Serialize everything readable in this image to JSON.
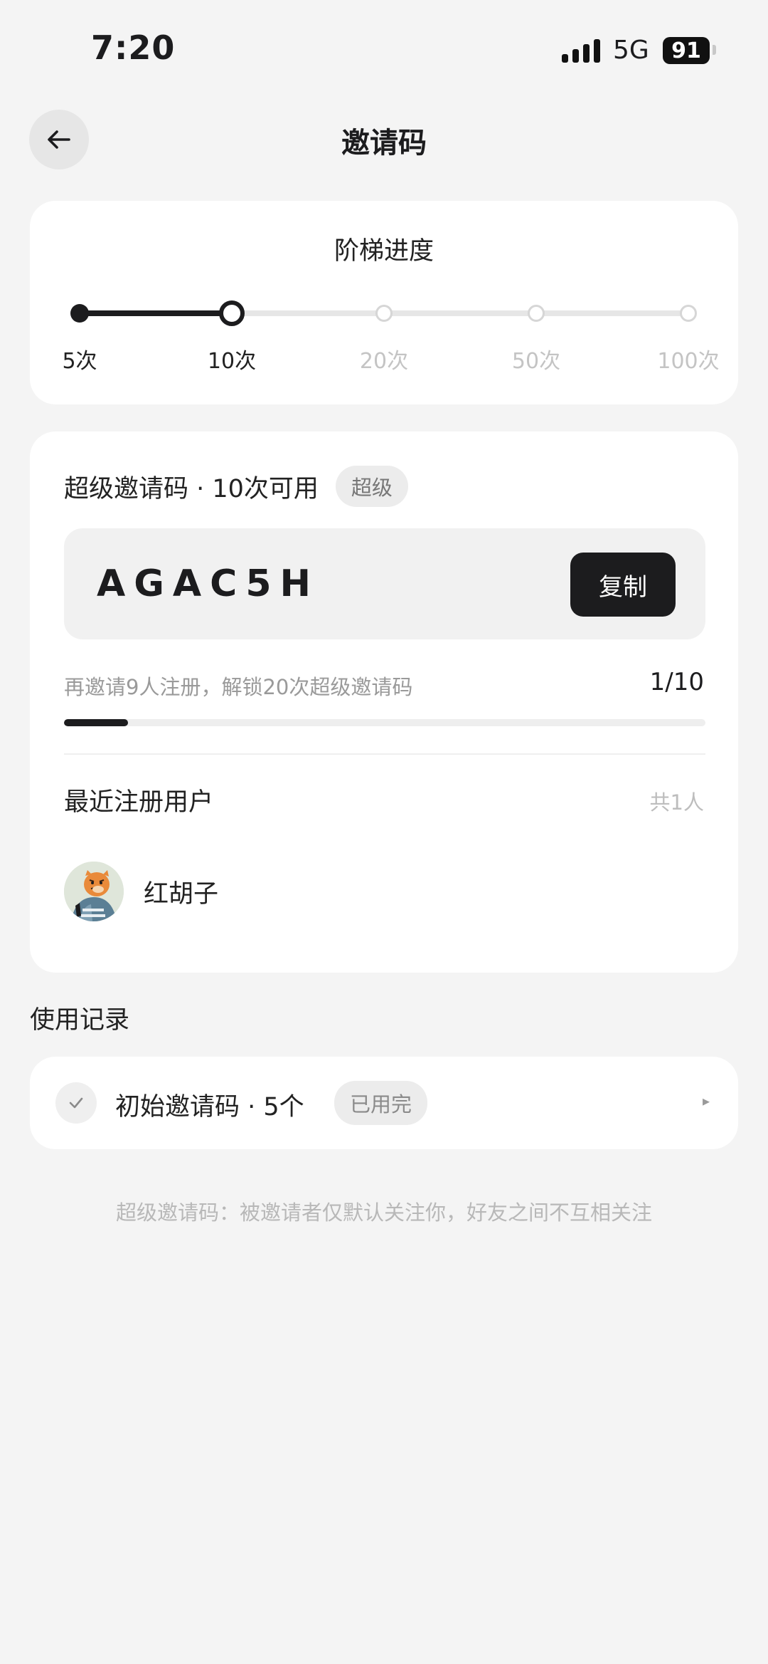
{
  "status_bar": {
    "time": "7:20",
    "network": "5G",
    "battery": "91"
  },
  "header": {
    "title": "邀请码",
    "back_icon": "arrow-left-icon"
  },
  "tiers": {
    "title": "阶梯进度",
    "current_index": 1,
    "items": [
      {
        "label": "5次",
        "state": "done"
      },
      {
        "label": "10次",
        "state": "current"
      },
      {
        "label": "20次",
        "state": "future"
      },
      {
        "label": "50次",
        "state": "future"
      },
      {
        "label": "100次",
        "state": "future"
      }
    ]
  },
  "invite": {
    "heading": "超级邀请码 · 10次可用",
    "badge": "超级",
    "code": "AGAC5H",
    "copy_label": "复制",
    "hint": "再邀请9人注册，解锁20次超级邀请码",
    "progress_text": "1/10",
    "progress_fraction": 0.1,
    "recent_title": "最近注册用户",
    "recent_count": "共1人",
    "users": [
      {
        "name": "红胡子",
        "avatar": "tiger-avatar"
      }
    ]
  },
  "usage": {
    "title": "使用记录",
    "items": [
      {
        "label": "初始邀请码 · 5个",
        "badge": "已用完",
        "icon": "check-icon",
        "arrow": "▸"
      }
    ]
  },
  "footnote": "超级邀请码：被邀请者仅默认关注你，好友之间不互相关注",
  "colors": {
    "background": "#f4f4f4",
    "card": "#ffffff",
    "accent": "#1c1c1e",
    "muted_text": "#9a9a9a"
  }
}
